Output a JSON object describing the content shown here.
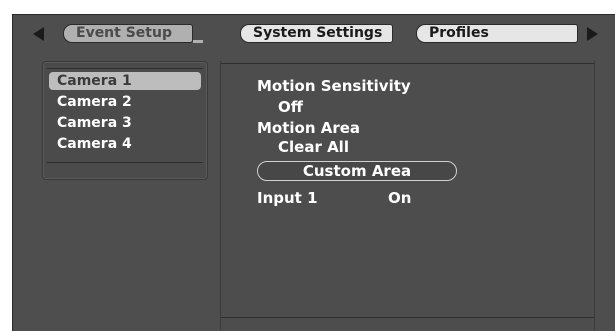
{
  "tabs": [
    {
      "label": "Event Setup",
      "active": true
    },
    {
      "label": "System Settings",
      "active": false
    },
    {
      "label": "Profiles",
      "active": false
    }
  ],
  "cameras": [
    {
      "label": "Camera 1",
      "selected": true
    },
    {
      "label": "Camera 2",
      "selected": false
    },
    {
      "label": "Camera 3",
      "selected": false
    },
    {
      "label": "Camera 4",
      "selected": false
    }
  ],
  "settings": {
    "motion_sensitivity_label": "Motion Sensitivity",
    "motion_sensitivity_value": "Off",
    "motion_area_label": "Motion Area",
    "motion_area_value": "Clear All",
    "custom_area_button": "Custom Area",
    "input_label": "Input 1",
    "input_value": "On"
  },
  "colors": {
    "screen_bg": "#4e4e4e",
    "active_tab": "#b0b0b0",
    "inactive_tab": "#e6e6e6",
    "selection": "#bdbdbd",
    "text": "#ffffff"
  }
}
